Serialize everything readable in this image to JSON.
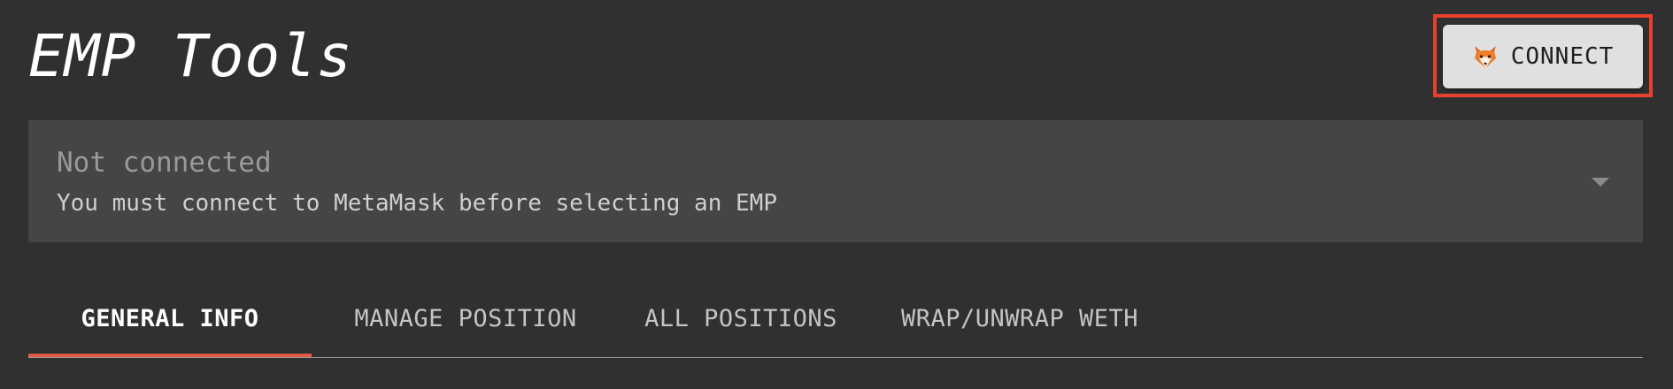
{
  "app": {
    "title": "EMP Tools"
  },
  "connect": {
    "label": "CONNECT",
    "icon": "fox-icon",
    "highlight_color": "#e8402c"
  },
  "emp_select": {
    "placeholder": "Not connected",
    "helper_text": "You must connect to MetaMask before selecting an EMP"
  },
  "tabs": [
    {
      "label": "GENERAL INFO",
      "active": true
    },
    {
      "label": "MANAGE POSITION",
      "active": false
    },
    {
      "label": "ALL POSITIONS",
      "active": false
    },
    {
      "label": "WRAP/UNWRAP WETH",
      "active": false
    }
  ],
  "colors": {
    "background": "#303030",
    "select_background": "#454545",
    "tab_indicator": "#e35a44",
    "button_background": "#e0e0e0"
  }
}
